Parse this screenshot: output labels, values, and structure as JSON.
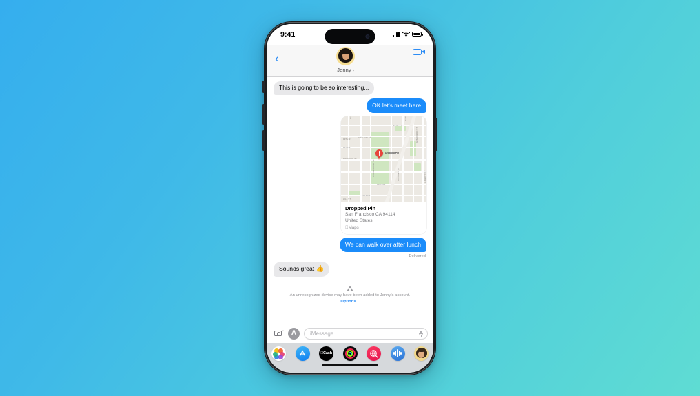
{
  "background": {
    "gradient_from": "#35aeee",
    "gradient_to": "#5fdcd3"
  },
  "device": {
    "status_bar": {
      "time": "9:41",
      "signal": "cellular-bars-icon",
      "wifi": "wifi-icon",
      "battery": "battery-full-icon"
    }
  },
  "chat_header": {
    "back_label": "‹",
    "contact_name": "Jenny",
    "contact_caret": "›",
    "facetime_label": "video-call"
  },
  "messages": [
    {
      "id": "m1",
      "direction": "in",
      "text": "This is going to be so interesting..."
    },
    {
      "id": "m2",
      "direction": "out",
      "text": "OK let's meet here"
    },
    {
      "id": "m3",
      "direction": "out",
      "type": "map"
    },
    {
      "id": "m4",
      "direction": "out",
      "text": "We can walk over after lunch"
    }
  ],
  "map_card": {
    "title": "Dropped Pin",
    "address_line1": "San Francisco CA 94114",
    "address_line2": "United States",
    "brand": "Maps",
    "pin_label": "Dropped Pin",
    "street_labels": [
      "DORLAND ST",
      "18TH ST",
      "HANCOCK ST",
      "19TH ST",
      "20TH ST",
      "CHURCH ST",
      "SANCHEZ ST",
      "DOLORES ST",
      "GUERRERO ST",
      "21ST ST",
      "HILL ST",
      "LIBERTY ST",
      "CUMBERLAND ST"
    ]
  },
  "delivery_status": "Delivered",
  "reply": {
    "text": "Sounds great",
    "emoji": "👍"
  },
  "warning": {
    "icon": "warning-triangle-icon",
    "text_before": "An unrecognized device may have been added to Jenny's account. ",
    "link_label": "Options..."
  },
  "input_bar": {
    "camera_label": "camera",
    "apps_label": "A",
    "placeholder": "iMessage",
    "mic_label": "dictate"
  },
  "app_drawer": [
    {
      "name": "photos",
      "label": ""
    },
    {
      "name": "app-store",
      "label": "ᴀ"
    },
    {
      "name": "apple-cash",
      "label": "Cash"
    },
    {
      "name": "fitness",
      "label": ""
    },
    {
      "name": "music",
      "label": ""
    },
    {
      "name": "voice-memo",
      "label": ""
    },
    {
      "name": "memoji",
      "label": ""
    }
  ],
  "colors": {
    "sent_bubble": "#1b8cfa",
    "received_bubble": "#e8e8ea",
    "accent": "#2b8cf5"
  }
}
